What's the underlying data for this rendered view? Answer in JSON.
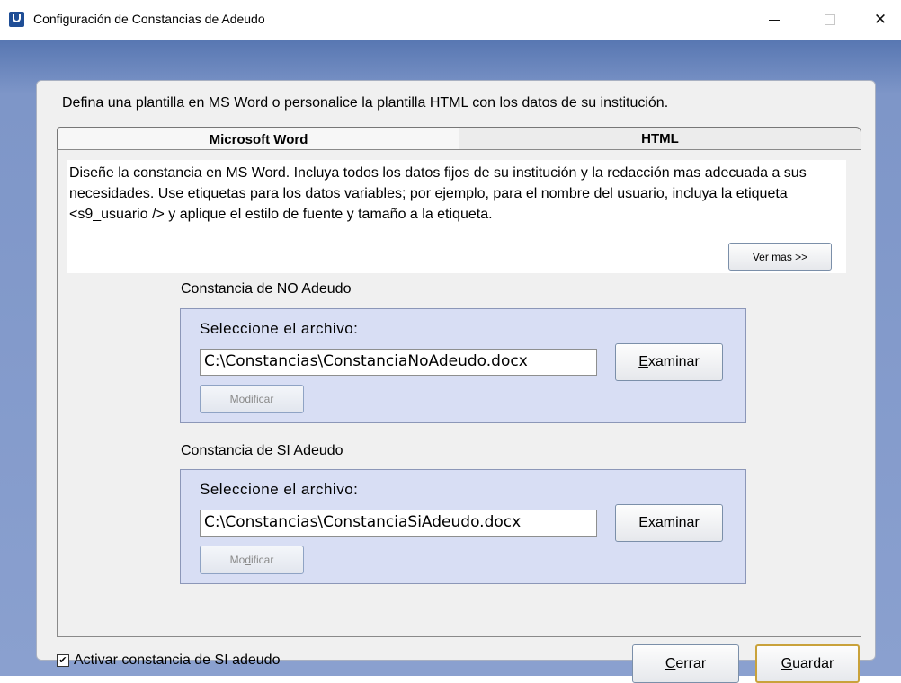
{
  "window": {
    "title": "Configuración de Constancias de Adeudo"
  },
  "intro": "Defina una plantilla en MS Word o personalice la plantilla HTML con los datos de su institución.",
  "tabs": [
    {
      "label": "Microsoft Word",
      "selected": true
    },
    {
      "label": "HTML",
      "selected": false
    }
  ],
  "description": {
    "text": "Diseñe la constancia en MS Word. Incluya todos los datos fijos de su institución y la redacción mas adecuada a sus necesidades.  Use etiquetas para los datos variables; por ejemplo, para el nombre del usuario, incluya la etiqueta <s9_usuario /> y aplique el estilo de fuente y tamaño a la etiqueta.",
    "more_button": "Ver mas >>"
  },
  "no_adeudo": {
    "group_label": "Constancia de NO Adeudo",
    "select_label": "Seleccione el archivo:",
    "path": "C:\\Constancias\\ConstanciaNoAdeudo.docx",
    "browse_label_accel": "E",
    "browse_label_rest": "xaminar",
    "modify_label_accel": "M",
    "modify_label_rest": "odificar"
  },
  "si_adeudo": {
    "group_label": "Constancia de SI Adeudo",
    "select_label": "Seleccione el archivo:",
    "path": "C:\\Constancias\\ConstanciaSiAdeudo.docx",
    "browse_label_before": "E",
    "browse_label_accel": "x",
    "browse_label_rest": "aminar",
    "modify_label_before": "Mo",
    "modify_label_accel": "d",
    "modify_label_rest": "ificar"
  },
  "footer": {
    "checkbox_label": "Activar constancia de SI adeudo",
    "checkbox_checked": true,
    "close_accel": "C",
    "close_rest": "errar",
    "save_accel": "G",
    "save_rest": "uardar"
  },
  "colors": {
    "background_top": "#5877b2",
    "background_bottom": "#8aa0cf",
    "group_fill": "#d8def4",
    "default_button_border": "#c9a23b"
  }
}
